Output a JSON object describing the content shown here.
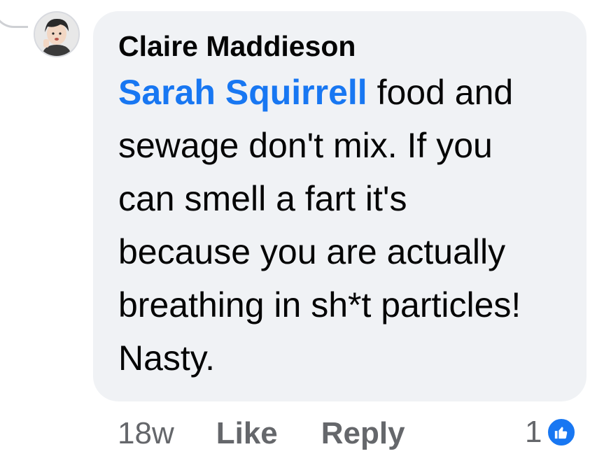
{
  "comment": {
    "author": "Claire Maddieson",
    "mention": "Sarah Squirrell",
    "text": " food and sewage don't mix. If you can smell a fart it's because you are actually breathing in sh*t particles! Nasty."
  },
  "actions": {
    "timestamp": "18w",
    "like_label": "Like",
    "reply_label": "Reply"
  },
  "reactions": {
    "count": "1",
    "icon": "thumbs-up-icon",
    "badge_color": "#1877f2"
  },
  "colors": {
    "bubble": "#f0f2f5",
    "mention": "#1877f2",
    "muted": "#65676b"
  }
}
